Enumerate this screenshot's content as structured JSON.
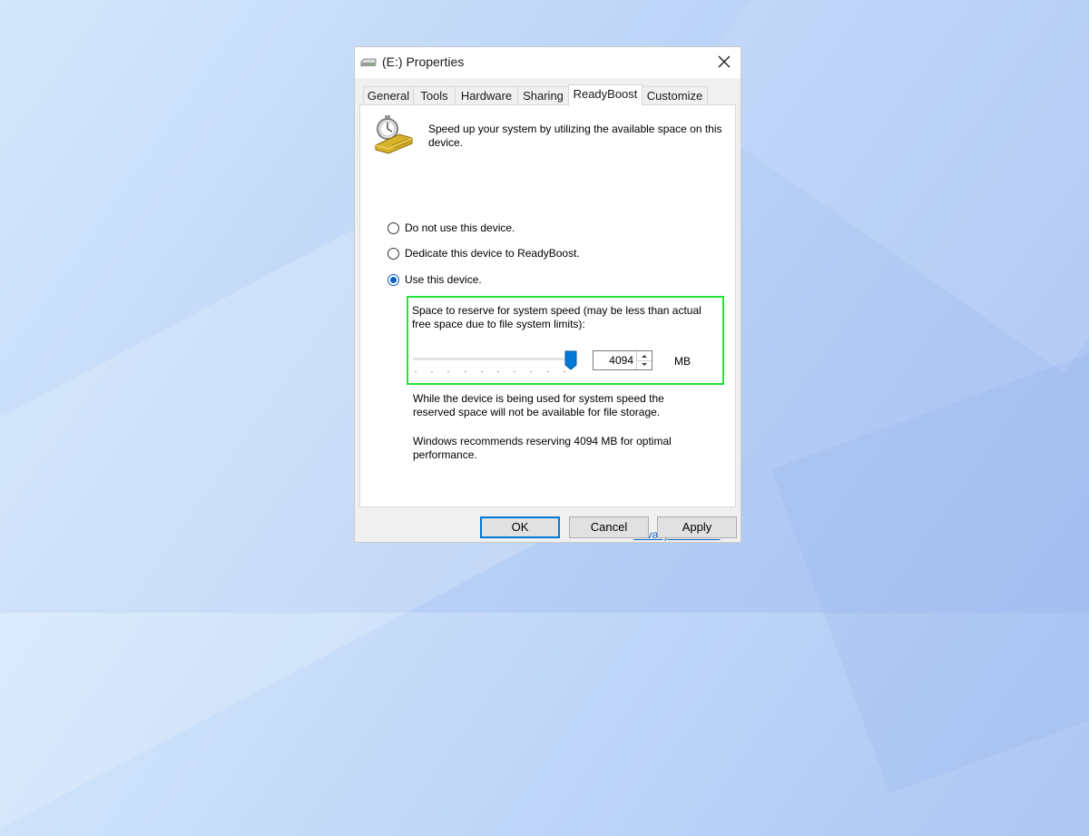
{
  "window": {
    "title": "(E:) Properties",
    "icon": "drive-icon",
    "close_icon": "close-icon"
  },
  "tabs": [
    {
      "label": "General"
    },
    {
      "label": "Tools"
    },
    {
      "label": "Hardware"
    },
    {
      "label": "Sharing"
    },
    {
      "label": "ReadyBoost",
      "active": true
    },
    {
      "label": "Customize"
    }
  ],
  "readyboost": {
    "icon": "stopwatch-icon",
    "intro": "Speed up your system by utilizing the available space on this device.",
    "options": [
      {
        "label": "Do not use this device.",
        "selected": false
      },
      {
        "label": "Dedicate this device to ReadyBoost.",
        "selected": false
      },
      {
        "label": "Use this device.",
        "selected": true
      }
    ],
    "space_label": "Space to reserve for system speed (may be less than actual free space due to file system limits):",
    "slider_level": 1.0,
    "space_value": "4094",
    "unit": "MB",
    "info_storage": "While the device is being used for system speed the reserved space will not be available for file storage.",
    "info_recommend": "Windows recommends reserving 4094 MB for optimal performance.",
    "privacy_link": "Privacy statement"
  },
  "buttons": {
    "ok": "OK",
    "cancel": "Cancel",
    "apply": "Apply"
  },
  "colors": {
    "accent": "#0078d7",
    "highlight_box": "#27e23a",
    "link": "#0b63c7"
  }
}
